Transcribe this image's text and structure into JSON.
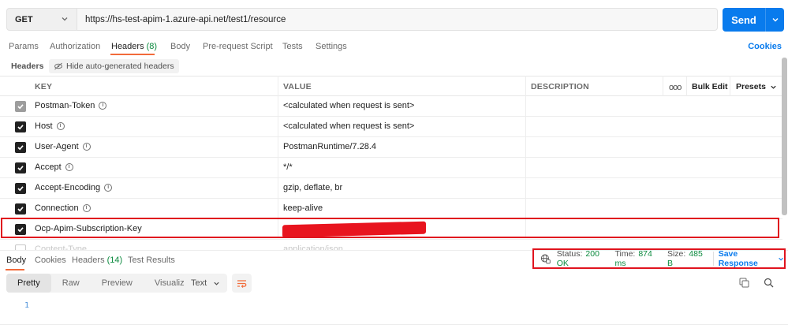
{
  "request": {
    "method": "GET",
    "url": "https://hs-test-apim-1.azure-api.net/test1/resource",
    "send_label": "Send"
  },
  "tabs": [
    {
      "label": "Params"
    },
    {
      "label": "Authorization"
    },
    {
      "label": "Headers",
      "count": "(8)",
      "active": true
    },
    {
      "label": "Body"
    },
    {
      "label": "Pre-request Script"
    },
    {
      "label": "Tests"
    },
    {
      "label": "Settings"
    }
  ],
  "cookies_label": "Cookies",
  "headers_bar": {
    "label": "Headers",
    "hide_auto": "Hide auto-generated headers"
  },
  "table": {
    "columns": {
      "key": "KEY",
      "value": "VALUE",
      "description": "DESCRIPTION"
    },
    "more": "ooo",
    "bulk_edit": "Bulk Edit",
    "presets": "Presets",
    "rows": [
      {
        "key": "Postman-Token",
        "value": "<calculated when request is sent>",
        "state": "disabled"
      },
      {
        "key": "Host",
        "value": "<calculated when request is sent>",
        "state": "checked"
      },
      {
        "key": "User-Agent",
        "value": "PostmanRuntime/7.28.4",
        "state": "checked"
      },
      {
        "key": "Accept",
        "value": "*/*",
        "state": "checked"
      },
      {
        "key": "Accept-Encoding",
        "value": "gzip, deflate, br",
        "state": "checked"
      },
      {
        "key": "Connection",
        "value": "keep-alive",
        "state": "checked"
      },
      {
        "key": "Ocp-Apim-Subscription-Key",
        "value": "",
        "state": "checked",
        "redacted": true
      },
      {
        "key": "Content-Type",
        "value": "application/json",
        "state": "unchecked"
      }
    ]
  },
  "response": {
    "tabs": [
      {
        "label": "Body",
        "active": true
      },
      {
        "label": "Cookies"
      },
      {
        "label": "Headers",
        "count": "(14)"
      },
      {
        "label": "Test Results"
      }
    ],
    "status_label": "Status:",
    "status_value": "200 OK",
    "time_label": "Time:",
    "time_value": "874 ms",
    "size_label": "Size:",
    "size_value": "485 B",
    "save_label": "Save Response",
    "view_modes": [
      "Pretty",
      "Raw",
      "Preview",
      "Visualize"
    ],
    "format": "Text",
    "line_number": "1"
  },
  "colors": {
    "accent": "#097bed",
    "active_tab": "#f26b3a",
    "count_green": "#0b8a3e",
    "highlight_red": "#e0141e"
  }
}
